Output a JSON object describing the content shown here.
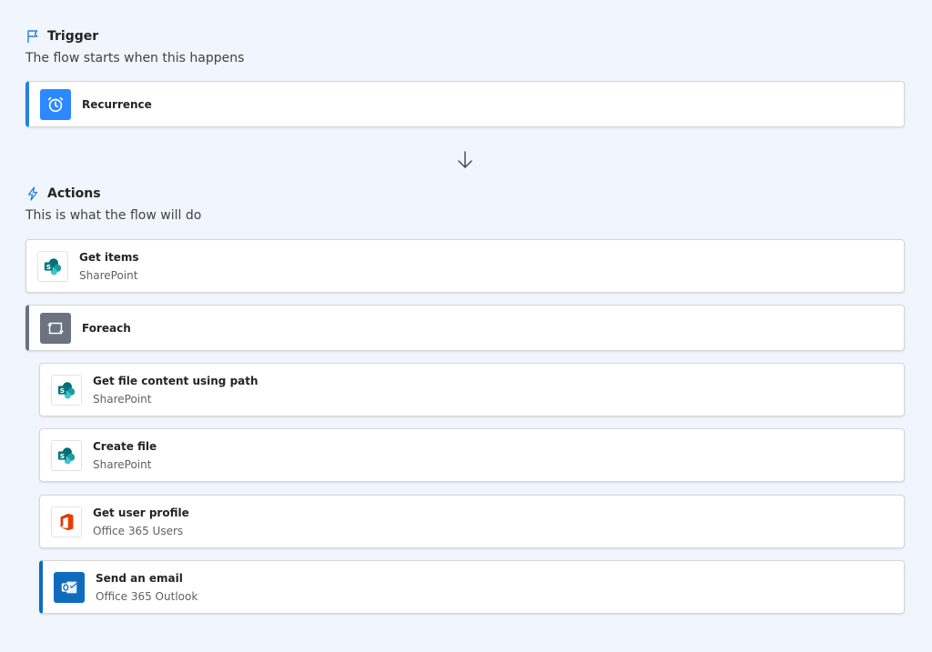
{
  "trigger": {
    "title": "Trigger",
    "subtitle": "The flow starts when this happens",
    "step": {
      "title": "Recurrence",
      "icon": "timer-icon",
      "color": "#2b88ff"
    }
  },
  "actions": {
    "title": "Actions",
    "subtitle": "This is what the flow will do",
    "steps": [
      {
        "title": "Get items",
        "connector": "SharePoint",
        "icon": "sharepoint-icon"
      },
      {
        "title": "Foreach",
        "icon": "loop-icon",
        "color": "#6b7280"
      },
      {
        "title": "Get file content using path",
        "connector": "SharePoint",
        "icon": "sharepoint-icon"
      },
      {
        "title": "Create file",
        "connector": "SharePoint",
        "icon": "sharepoint-icon"
      },
      {
        "title": "Get user profile",
        "connector": "Office 365 Users",
        "icon": "office-icon"
      },
      {
        "title": "Send an email",
        "connector": "Office 365 Outlook",
        "icon": "outlook-icon",
        "color": "#0f6cbd"
      }
    ]
  },
  "colors": {
    "background": "#f1f5fd",
    "accent": "#0f6cbd",
    "sharepoint": "#038387"
  }
}
